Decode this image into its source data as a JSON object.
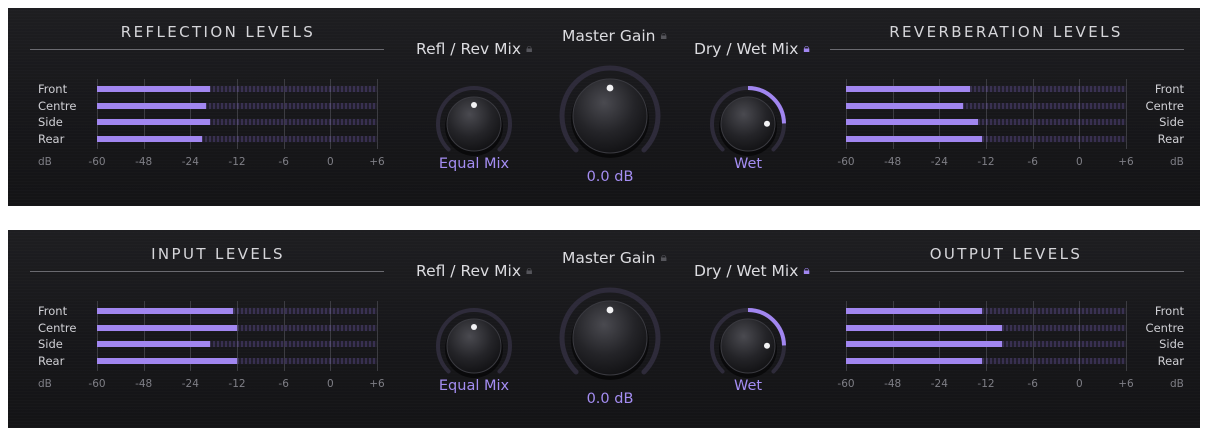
{
  "panels": [
    {
      "left_title": "REFLECTION LEVELS",
      "right_title": "REVERBERATION LEVELS",
      "left_meter": {
        "levels_db": [
          -19,
          -20,
          -19,
          -21
        ]
      },
      "right_meter": {
        "levels_db": [
          -16,
          -18,
          -14,
          -13
        ]
      }
    },
    {
      "left_title": "INPUT LEVELS",
      "right_title": "OUTPUT LEVELS",
      "left_meter": {
        "levels_db": [
          -13,
          -12,
          -19,
          -12
        ]
      },
      "right_meter": {
        "levels_db": [
          -13,
          -10,
          -10,
          -13
        ]
      }
    }
  ],
  "channels": [
    "Front",
    "Centre",
    "Side",
    "Rear"
  ],
  "scale_labels": [
    "-60",
    "-48",
    "-24",
    "-12",
    "-6",
    "0",
    "+6"
  ],
  "unit_label": "dB",
  "knobs": {
    "mix": {
      "title": "Refl / Rev Mix",
      "value": "Equal Mix",
      "locked": false,
      "position": 0.5
    },
    "gain": {
      "title": "Master Gain",
      "value": "0.0 dB",
      "locked": false,
      "position": 0.5
    },
    "drywet": {
      "title": "Dry / Wet Mix",
      "value": "Wet",
      "locked": true,
      "position": 0.83
    }
  },
  "icons": {
    "lock": "lock-icon",
    "lock_open": "lock-open-icon"
  },
  "colors": {
    "accent": "#a186f0",
    "panel": "#1b1b1e",
    "text": "#d6d6da",
    "muted": "#7f7f86"
  }
}
